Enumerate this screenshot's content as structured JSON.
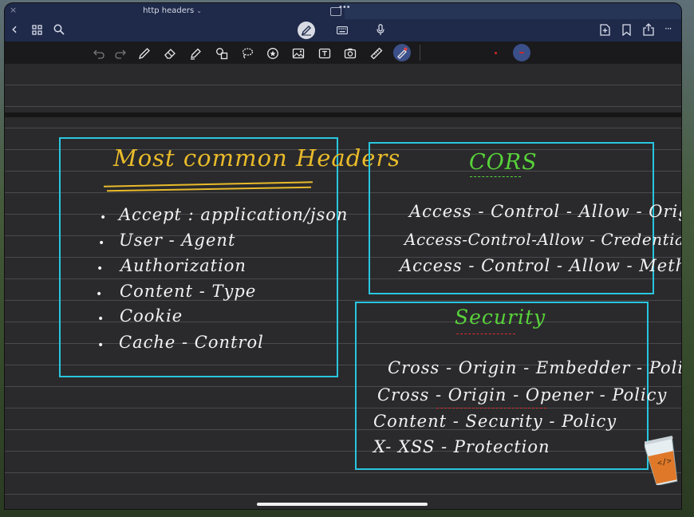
{
  "titlebar": {
    "close": "×",
    "title": "http headers",
    "chevron": "⌄"
  },
  "navbar": {
    "icons": [
      "back-chevron-icon",
      "grid-icon",
      "search-icon",
      "pen-mode-icon",
      "keyboard-icon",
      "microphone-icon",
      "add-page-icon",
      "bookmark-icon",
      "share-icon",
      "more-icon"
    ],
    "back": "‹",
    "more": "···"
  },
  "toolbar": {
    "tools": [
      "undo-icon",
      "redo-icon",
      "pen-icon",
      "eraser-icon",
      "highlighter-icon",
      "shapes-icon",
      "lasso-icon",
      "sticker-icon",
      "image-icon",
      "text-icon",
      "camera-icon",
      "ruler-icon",
      "laser-pointer-icon"
    ],
    "selected_tool": "laser-pointer-icon",
    "colors": [
      "#d02828"
    ]
  },
  "note": {
    "headers_box": {
      "title": "Most common Headers",
      "items": [
        "Accept : application/json",
        "User - Agent",
        "Authorization",
        "Content - Type",
        "Cookie",
        "Cache - Control"
      ]
    },
    "cors_box": {
      "title": "CORS",
      "items": [
        "Access - Control - Allow - Origin",
        "Access-Control-Allow - Credentials",
        "Access - Control - Allow - Method"
      ]
    },
    "security_box": {
      "title": "Security",
      "items": [
        "Cross - Origin - Embedder - Policy",
        "Cross - Origin - Opener - Policy",
        "Content - Security - Policy",
        "X- XSS - Protection"
      ]
    },
    "cup_label": "</>"
  },
  "colors": {
    "box_border": "#28c6df",
    "title_yellow": "#e9bb2a",
    "title_green": "#58d33a",
    "ink": "#f2f2f2",
    "chrome": "#1f2a4a"
  }
}
